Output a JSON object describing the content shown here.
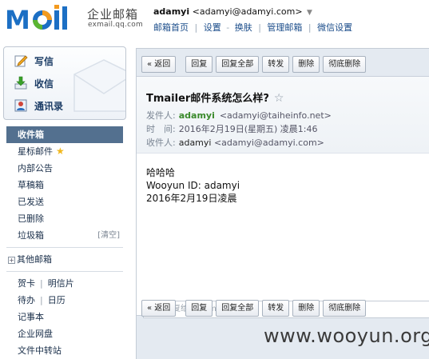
{
  "header": {
    "logo_text": "Mail",
    "brand": "企业邮箱",
    "domain": "exmail.qq.com",
    "user_name": "adamyi",
    "user_email": "<adamyi@adamyi.com>",
    "user_caret": "▼",
    "nav": [
      "邮箱首页",
      "设置",
      "换肤",
      "管理邮箱",
      "微信设置"
    ],
    "nav_sep": "|",
    "nav_dash": "-"
  },
  "sidebar": {
    "quick": [
      {
        "label": "写信",
        "icon": "compose-icon"
      },
      {
        "label": "收信",
        "icon": "inbox-download-icon"
      },
      {
        "label": "通讯录",
        "icon": "contacts-icon"
      }
    ],
    "folders": [
      {
        "label": "收件箱",
        "active": true
      },
      {
        "label": "星标邮件",
        "star": "★"
      },
      {
        "label": "内部公告"
      },
      {
        "label": "草稿箱"
      },
      {
        "label": "已发送"
      },
      {
        "label": "已删除"
      },
      {
        "label": "垃圾箱",
        "action": "[清空]"
      }
    ],
    "other_group": "其他邮箱",
    "other_group_plus": "+",
    "apps": {
      "row1": [
        "贺卡",
        "明信片"
      ],
      "row2": [
        "待办",
        "日历"
      ],
      "notes": "记事本",
      "disk": "企业网盘",
      "transfer": "文件中转站"
    }
  },
  "toolbar": {
    "back": "« 返回",
    "reply": "回复",
    "reply_all": "回复全部",
    "forward": "转发",
    "delete": "删除",
    "delete_forever": "彻底删除"
  },
  "mail": {
    "subject": "Tmailer邮件系统怎么样?",
    "fav_icon": "☆",
    "from_label": "发件人:",
    "from_name": "adamyi",
    "from_addr": "<adamyi@taiheinfo.net>",
    "time_label": "时　间:",
    "time_value": "2016年2月19日(星期五) 凌晨1:46",
    "to_label": "收件人:",
    "to_name": "adamyi",
    "to_addr": "<adamyi@adamyi.com>",
    "body": [
      "哈哈哈",
      "Wooyun ID: adamyi",
      "2016年2月19日凌晨"
    ]
  },
  "quick_reply_placeholder": "快捷回复给: adamyi",
  "watermark": "www.wooyun.org",
  "colors": {
    "active_folder": "#53708f",
    "sender_green": "#3a8a2b",
    "link_blue": "#1a4c8a",
    "logo_blue": "#1c6fc4",
    "logo_orange": "#f39a1e"
  }
}
